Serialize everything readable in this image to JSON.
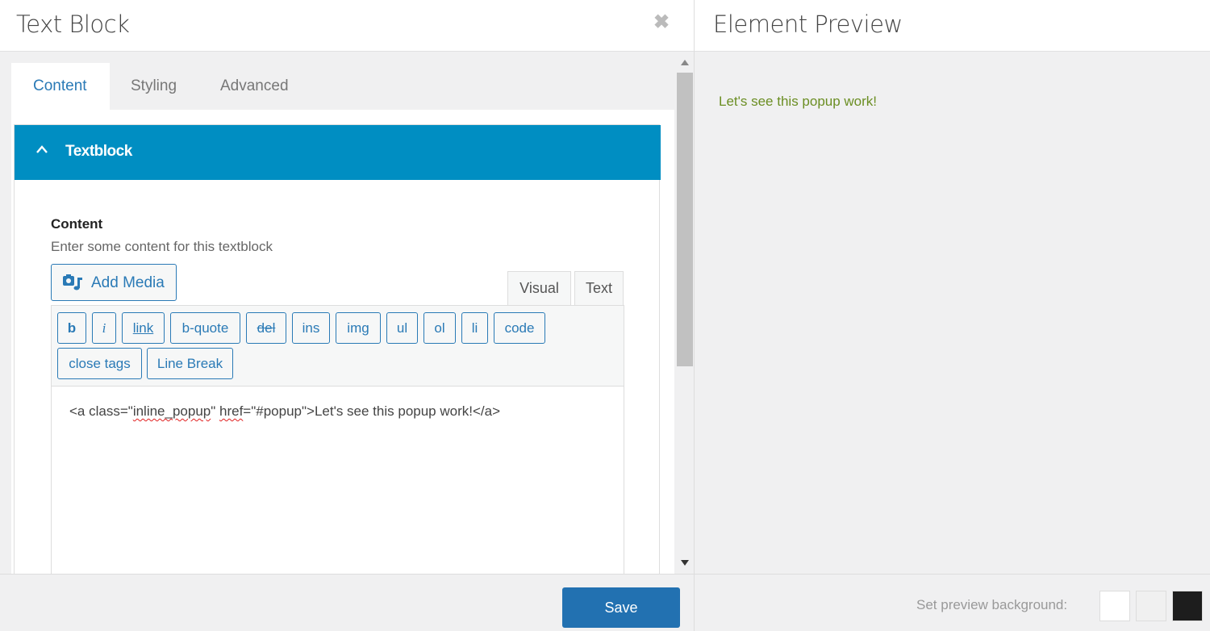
{
  "left_panel": {
    "title": "Text Block",
    "close_icon": "close-icon",
    "tabs": [
      {
        "label": "Content",
        "active": true
      },
      {
        "label": "Styling",
        "active": false
      },
      {
        "label": "Advanced",
        "active": false
      }
    ],
    "section": {
      "title": "Textblock",
      "field_label": "Content",
      "field_description": "Enter some content for this textblock",
      "add_media_label": "Add Media",
      "mode_tabs": {
        "visual": "Visual",
        "text": "Text"
      },
      "quicktags_row1": [
        "b",
        "i",
        "link",
        "b-quote",
        "del",
        "ins",
        "img",
        "ul",
        "ol",
        "li",
        "code"
      ],
      "quicktags_row2": [
        "close tags",
        "Line Break"
      ],
      "editor_content": {
        "part1": "<a class=\"",
        "part2": "inline_popup",
        "part3": "\" ",
        "part4": "href",
        "part5": "=\"#popup\">Let's see this popup work!</a>"
      }
    },
    "footer": {
      "save_label": "Save"
    }
  },
  "right_panel": {
    "title": "Element Preview",
    "preview_text": "Let's see this popup work!",
    "footer": {
      "bg_label": "Set preview background:",
      "swatches": [
        "#ffffff",
        "#f0f0f0",
        "#1d1d1d"
      ]
    }
  },
  "colors": {
    "accent": "#008ec2",
    "link": "#2a7ab6",
    "save": "#2271b1",
    "preview_text": "#6b8e23"
  }
}
